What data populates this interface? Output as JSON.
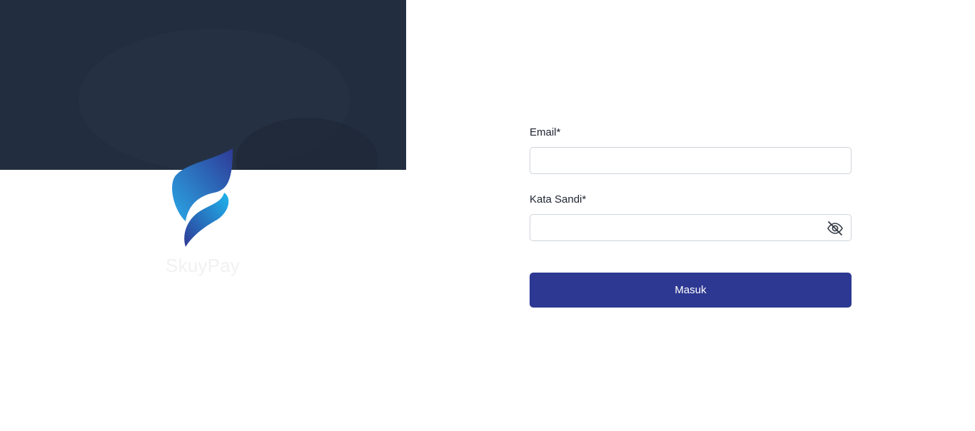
{
  "brand": {
    "name": "SkuyPay",
    "logo_icon": "skuypay-logo-icon",
    "colors": {
      "logo_light": "#2aa8e6",
      "logo_dark": "#2e3a96"
    }
  },
  "hero": {
    "background_color": "#222e40"
  },
  "form": {
    "email": {
      "label": "Email*",
      "value": "",
      "placeholder": ""
    },
    "password": {
      "label": "Kata Sandi*",
      "value": "",
      "placeholder": "",
      "toggle_icon": "eye-off-icon"
    },
    "submit_label": "Masuk",
    "accent_color": "#2d3892"
  }
}
